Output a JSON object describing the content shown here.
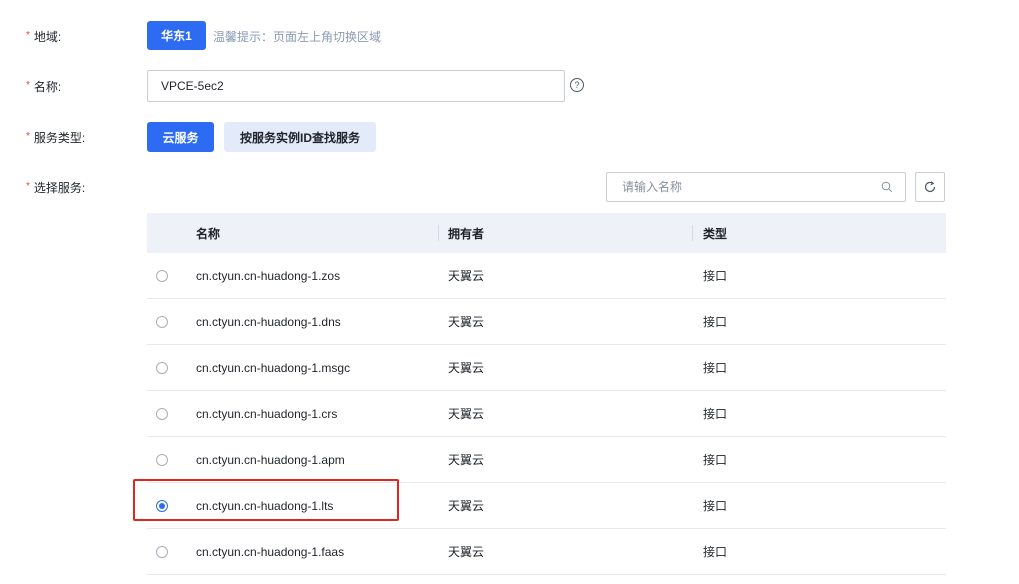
{
  "form": {
    "region": {
      "label": "地域:",
      "value": "华东1",
      "tip": "温馨提示：页面左上角切换区域"
    },
    "name": {
      "label": "名称:",
      "value": "VPCE-5ec2",
      "help": "?"
    },
    "service_type": {
      "label": "服务类型:",
      "options": [
        "云服务",
        "按服务实例ID查找服务"
      ],
      "selected": "云服务"
    },
    "select_service": {
      "label": "选择服务:",
      "search_placeholder": "请输入名称"
    }
  },
  "required_mark": "*",
  "table": {
    "columns": [
      "名称",
      "拥有者",
      "类型"
    ],
    "rows": [
      {
        "name": "cn.ctyun.cn-huadong-1.zos",
        "owner": "天翼云",
        "type": "接口",
        "selected": false
      },
      {
        "name": "cn.ctyun.cn-huadong-1.dns",
        "owner": "天翼云",
        "type": "接口",
        "selected": false
      },
      {
        "name": "cn.ctyun.cn-huadong-1.msgc",
        "owner": "天翼云",
        "type": "接口",
        "selected": false
      },
      {
        "name": "cn.ctyun.cn-huadong-1.crs",
        "owner": "天翼云",
        "type": "接口",
        "selected": false
      },
      {
        "name": "cn.ctyun.cn-huadong-1.apm",
        "owner": "天翼云",
        "type": "接口",
        "selected": false
      },
      {
        "name": "cn.ctyun.cn-huadong-1.lts",
        "owner": "天翼云",
        "type": "接口",
        "selected": true
      },
      {
        "name": "cn.ctyun.cn-huadong-1.faas",
        "owner": "天翼云",
        "type": "接口",
        "selected": false
      }
    ]
  },
  "icons": {
    "search": "search-icon",
    "refresh": "refresh-icon",
    "help": "question-circle-icon"
  },
  "colors": {
    "primary": "#2d6cf2",
    "secondary_bg": "#e3ebfb",
    "highlight": "#e1261c",
    "required": "#f53f3f"
  }
}
